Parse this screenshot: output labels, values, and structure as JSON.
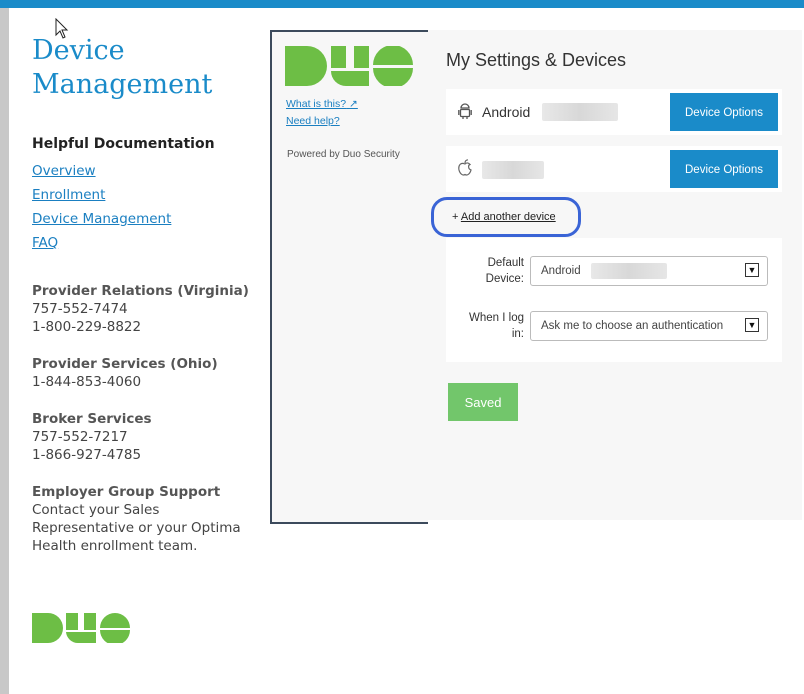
{
  "sidebar": {
    "title_line1": "Device",
    "title_line2": "Management",
    "doc_heading": "Helpful Documentation",
    "doc_links": [
      "Overview",
      "Enrollment",
      "Device Management",
      "FAQ"
    ],
    "contacts": [
      {
        "heading": "Provider Relations (Virginia)",
        "lines": [
          "757-552-7474",
          "1-800-229-8822"
        ]
      },
      {
        "heading": "Provider Services (Ohio)",
        "lines": [
          "1-844-853-4060"
        ]
      },
      {
        "heading": "Broker Services",
        "lines": [
          "757-552-7217",
          "1-866-927-4785"
        ]
      },
      {
        "heading": "Employer Group Support",
        "lines": [
          "Contact your Sales",
          "Representative or your Optima",
          "Health enrollment team."
        ]
      }
    ]
  },
  "duo_frame": {
    "what_is_this": "What is this?",
    "need_help": "Need help?",
    "powered_by": "Powered by Duo Security"
  },
  "main": {
    "title": "My Settings & Devices",
    "devices": [
      {
        "icon": "android-icon",
        "name": "Android",
        "button": "Device Options"
      },
      {
        "icon": "apple-icon",
        "name": "",
        "button": "Device Options"
      }
    ],
    "add_device": "Add another device",
    "default_device_label": "Default Device:",
    "default_device_value": "Android",
    "when_login_label": "When I log in:",
    "when_login_value": "Ask me to choose an authentication",
    "saved_button": "Saved"
  },
  "colors": {
    "accent": "#1a8bc9",
    "saved": "#72c66b",
    "highlight": "#3a64d6"
  }
}
